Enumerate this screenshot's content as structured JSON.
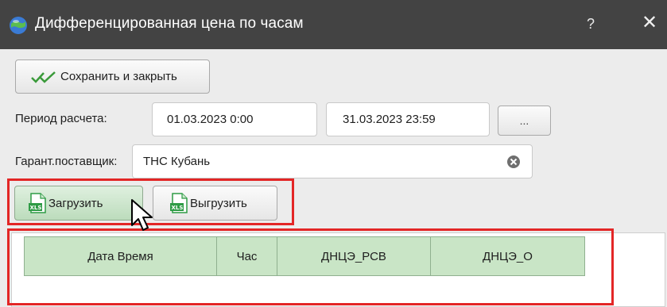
{
  "window": {
    "title": "Дифференцированная цена по часам",
    "help_label": "?",
    "close_label": "✕"
  },
  "toolbar": {
    "save_close_label": "Сохранить и закрыть"
  },
  "period": {
    "label": "Период расчета:",
    "start": "01.03.2023 0:00",
    "end": "31.03.2023 23:59",
    "picker_label": "..."
  },
  "supplier": {
    "label": "Гарант.поставщик:",
    "value": "ТНС Кубань"
  },
  "actions": {
    "load_label": "Загрузить",
    "unload_label": "Выгрузить"
  },
  "table": {
    "columns": [
      "Дата Время",
      "Час",
      "ДНЦЭ_РСВ",
      "ДНЦЭ_О"
    ]
  },
  "colors": {
    "titlebar": "#434343",
    "highlight": "#e32626",
    "header_green": "#c9e5c6",
    "excel_green": "#2e9b45"
  }
}
